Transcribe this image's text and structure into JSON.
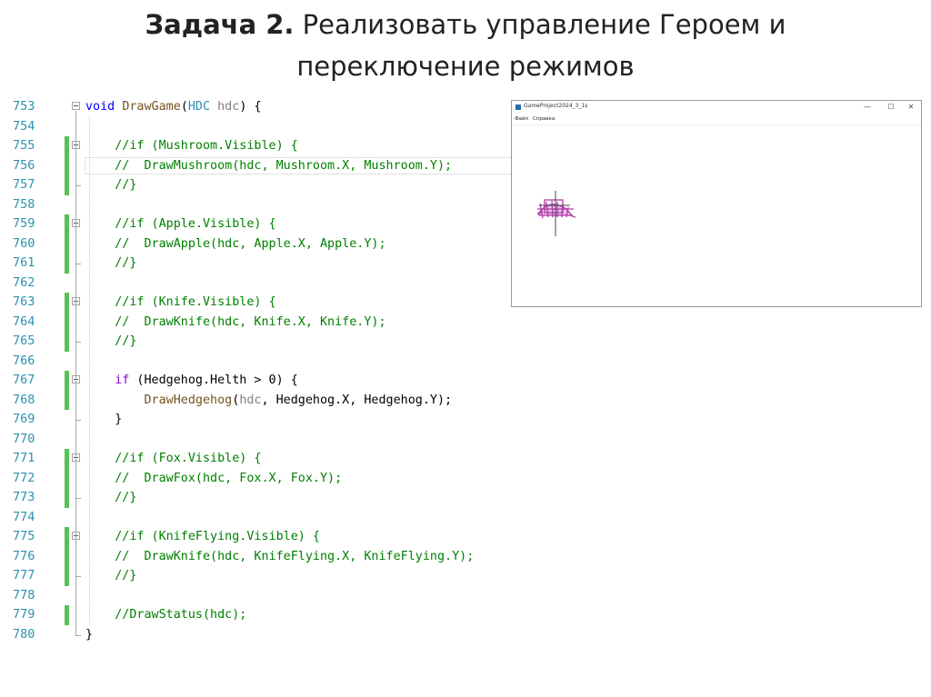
{
  "slide": {
    "title_bold": "Задача 2.",
    "title_rest": " Реализовать управление Героем и",
    "title_line2": "переключение режимов"
  },
  "code": {
    "lines": [
      {
        "n": "753",
        "segs": [
          [
            "kw",
            "void"
          ],
          [
            "tx",
            " "
          ],
          [
            "fn",
            "DrawGame"
          ],
          [
            "tx",
            "("
          ],
          [
            "ty",
            "HDC"
          ],
          [
            "tx",
            " "
          ],
          [
            "pr",
            "hdc"
          ],
          [
            "tx",
            ") {"
          ]
        ]
      },
      {
        "n": "754",
        "segs": []
      },
      {
        "n": "755",
        "segs": [
          [
            "tx",
            "    "
          ],
          [
            "cm",
            "//if (Mushroom.Visible) {"
          ]
        ]
      },
      {
        "n": "756",
        "segs": [
          [
            "tx",
            "    "
          ],
          [
            "cm",
            "//  DrawMushroom(hdc, Mushroom.X, Mushroom.Y);"
          ]
        ]
      },
      {
        "n": "757",
        "segs": [
          [
            "tx",
            "    "
          ],
          [
            "cm",
            "//}"
          ]
        ]
      },
      {
        "n": "758",
        "segs": []
      },
      {
        "n": "759",
        "segs": [
          [
            "tx",
            "    "
          ],
          [
            "cm",
            "//if (Apple.Visible) {"
          ]
        ]
      },
      {
        "n": "760",
        "segs": [
          [
            "tx",
            "    "
          ],
          [
            "cm",
            "//  DrawApple(hdc, Apple.X, Apple.Y);"
          ]
        ]
      },
      {
        "n": "761",
        "segs": [
          [
            "tx",
            "    "
          ],
          [
            "cm",
            "//}"
          ]
        ]
      },
      {
        "n": "762",
        "segs": []
      },
      {
        "n": "763",
        "segs": [
          [
            "tx",
            "    "
          ],
          [
            "cm",
            "//if (Knife.Visible) {"
          ]
        ]
      },
      {
        "n": "764",
        "segs": [
          [
            "tx",
            "    "
          ],
          [
            "cm",
            "//  DrawKnife(hdc, Knife.X, Knife.Y);"
          ]
        ]
      },
      {
        "n": "765",
        "segs": [
          [
            "tx",
            "    "
          ],
          [
            "cm",
            "//}"
          ]
        ]
      },
      {
        "n": "766",
        "segs": []
      },
      {
        "n": "767",
        "segs": [
          [
            "tx",
            "    "
          ],
          [
            "kw2",
            "if"
          ],
          [
            "tx",
            " (Hedgehog.Helth > 0) {"
          ]
        ]
      },
      {
        "n": "768",
        "segs": [
          [
            "tx",
            "        "
          ],
          [
            "fn",
            "DrawHedgehog"
          ],
          [
            "tx",
            "("
          ],
          [
            "pr",
            "hdc"
          ],
          [
            "tx",
            ", Hedgehog.X, Hedgehog.Y);"
          ]
        ]
      },
      {
        "n": "769",
        "segs": [
          [
            "tx",
            "    }"
          ]
        ]
      },
      {
        "n": "770",
        "segs": []
      },
      {
        "n": "771",
        "segs": [
          [
            "tx",
            "    "
          ],
          [
            "cm",
            "//if (Fox.Visible) {"
          ]
        ]
      },
      {
        "n": "772",
        "segs": [
          [
            "tx",
            "    "
          ],
          [
            "cm",
            "//  DrawFox(hdc, Fox.X, Fox.Y);"
          ]
        ]
      },
      {
        "n": "773",
        "segs": [
          [
            "tx",
            "    "
          ],
          [
            "cm",
            "//}"
          ]
        ]
      },
      {
        "n": "774",
        "segs": []
      },
      {
        "n": "775",
        "segs": [
          [
            "tx",
            "    "
          ],
          [
            "cm",
            "//if (KnifeFlying.Visible) {"
          ]
        ]
      },
      {
        "n": "776",
        "segs": [
          [
            "tx",
            "    "
          ],
          [
            "cm",
            "//  DrawKnife(hdc, KnifeFlying.X, KnifeFlying.Y);"
          ]
        ]
      },
      {
        "n": "777",
        "segs": [
          [
            "tx",
            "    "
          ],
          [
            "cm",
            "//}"
          ]
        ]
      },
      {
        "n": "778",
        "segs": []
      },
      {
        "n": "779",
        "segs": [
          [
            "tx",
            "    "
          ],
          [
            "cm",
            "//DrawStatus(hdc);"
          ]
        ]
      },
      {
        "n": "780",
        "segs": [
          [
            "tx",
            "}"
          ]
        ]
      }
    ]
  },
  "app": {
    "title": "GameProject2024_3_1s",
    "controls": [
      "—",
      "☐",
      "✕"
    ],
    "menu": [
      "Файл",
      "Справка"
    ]
  },
  "colors": {
    "keyword": "#0000ff",
    "comment": "#008000",
    "function": "#74531f",
    "type": "#2b91af",
    "line_number": "#2b91af",
    "change_bar": "#57c057",
    "sprite": "#b03aa8"
  },
  "icons": [
    "fold-minus-icon",
    "app-icon",
    "minimize-icon",
    "maximize-icon",
    "close-icon"
  ]
}
